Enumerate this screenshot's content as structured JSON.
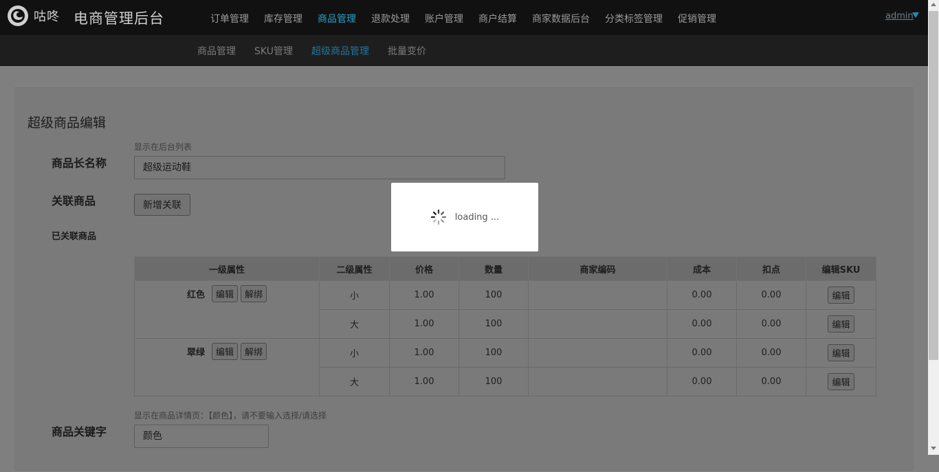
{
  "brand": {
    "name": "咕咚",
    "title": "电商管理后台"
  },
  "topnav": {
    "items": [
      "订单管理",
      "库存管理",
      "商品管理",
      "退款处理",
      "账户管理",
      "商户结算",
      "商家数据后台",
      "分类标签管理",
      "促销管理"
    ],
    "active_index": 2
  },
  "user": {
    "name": "admin"
  },
  "subnav": {
    "items": [
      "商品管理",
      "SKU管理",
      "超级商品管理",
      "批量变价"
    ],
    "active_index": 2
  },
  "form": {
    "section_title": "超级商品编辑",
    "name_label": "商品长名称",
    "name_hint": "显示在后台列表",
    "name_value": "超级运动鞋",
    "related_label": "关联商品",
    "add_related_button": "新增关联",
    "linked_label": "已关联商品",
    "keyword_label": "商品关键字",
    "keyword_hint": "显示在商品详情页：【颜色】，请不要输入选择/请选择",
    "keyword_value": "颜色"
  },
  "table": {
    "headers": [
      "一级属性",
      "二级属性",
      "价格",
      "数量",
      "商家编码",
      "成本",
      "扣点",
      "编辑SKU"
    ],
    "edit_label": "编辑",
    "unbind_label": "解绑",
    "groups": [
      {
        "attr1": "红色",
        "rows": [
          {
            "attr2": "小",
            "price": "1.00",
            "qty": "100",
            "code": "",
            "cost": "0.00",
            "commission": "0.00"
          },
          {
            "attr2": "大",
            "price": "1.00",
            "qty": "100",
            "code": "",
            "cost": "0.00",
            "commission": "0.00"
          }
        ]
      },
      {
        "attr1": "翠绿",
        "rows": [
          {
            "attr2": "小",
            "price": "1.00",
            "qty": "100",
            "code": "",
            "cost": "0.00",
            "commission": "0.00"
          },
          {
            "attr2": "大",
            "price": "1.00",
            "qty": "100",
            "code": "",
            "cost": "0.00",
            "commission": "0.00"
          }
        ]
      }
    ]
  },
  "loading": {
    "text": "loading ..."
  },
  "colors": {
    "accent": "#2aa0c7",
    "topbar": "#111111",
    "overlay_page": "#7f7f7f"
  }
}
